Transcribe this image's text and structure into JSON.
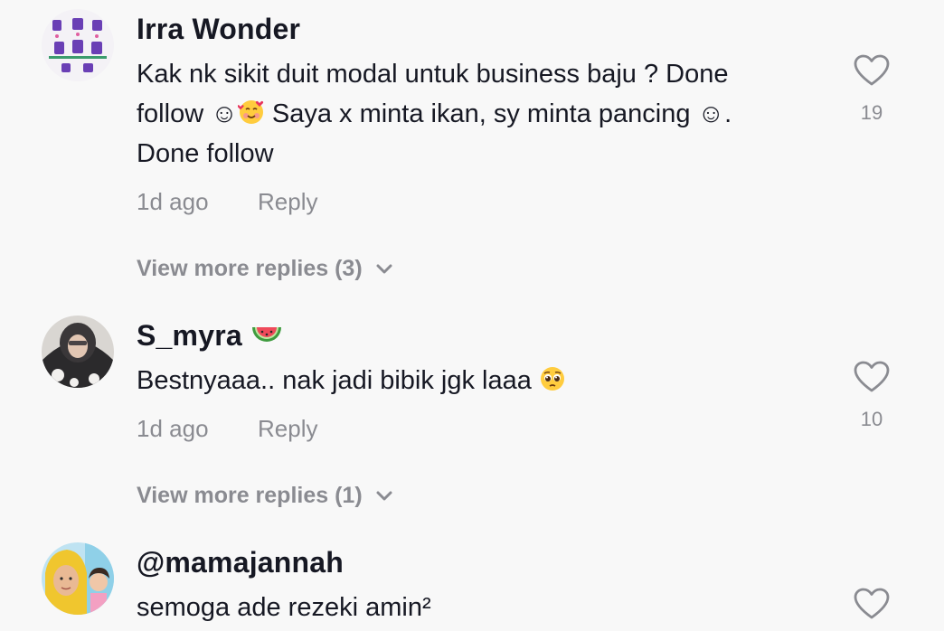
{
  "comments": [
    {
      "username": "Irra Wonder",
      "text_line1": "Kak nk sikit duit modal untuk business baju ? Done",
      "text_line2_a": "follow ☺",
      "text_line2_b": " Saya x minta ikan, sy minta pancing ☺.",
      "text_line3": "Done follow",
      "time": "1d ago",
      "reply_label": "Reply",
      "view_more": "View more replies (3)",
      "likes": "19"
    },
    {
      "username": "S_myra",
      "text": "Bestnyaaa.. nak jadi bibik jgk laaa ",
      "time": "1d ago",
      "reply_label": "Reply",
      "view_more": "View more replies (1)",
      "likes": "10"
    },
    {
      "username": "@mamajannah",
      "text": "semoga ade rezeki amin²"
    }
  ],
  "icons": {
    "like": "heart-outline-icon",
    "expand": "chevron-down-icon"
  },
  "colors": {
    "background": "#f8f8f8",
    "text": "#161823",
    "secondary": "#8a8b91"
  }
}
